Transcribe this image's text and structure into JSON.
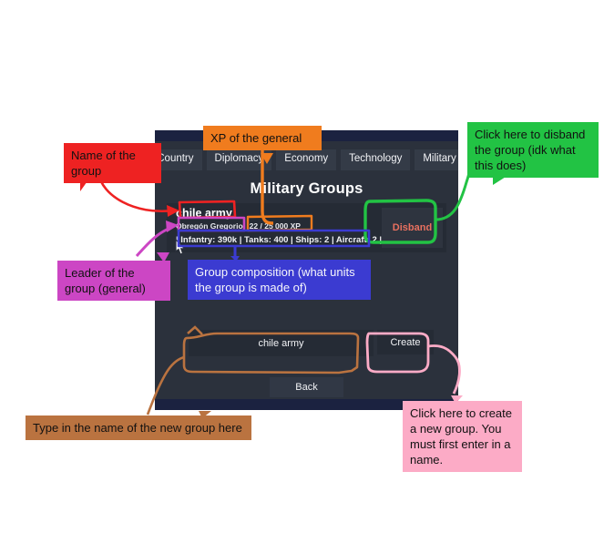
{
  "panel": {
    "title": "Military Groups",
    "nav_tabs": [
      {
        "label": "Country"
      },
      {
        "label": "Diplomacy"
      },
      {
        "label": "Economy"
      },
      {
        "label": "Technology"
      },
      {
        "label": "Military"
      }
    ],
    "groups": [
      {
        "name": "chile army",
        "general": "Obregón Gregorio",
        "xp": "22 / 25 000 XP",
        "units": "| Infantry: 390k | Tanks: 400 | Ships: 2 | Aircraft: 2 |",
        "disband_label": "Disband"
      }
    ],
    "create": {
      "input_value": "chile army",
      "input_placeholder": "",
      "create_label": "Create"
    },
    "back_label": "Back"
  },
  "annotations": {
    "name_of_group": "Name of the group",
    "xp_of_general": "XP of the general",
    "disband_group": "Click here to disband the group (idk what this does)",
    "leader_of_group": "Leader of the group (general)",
    "group_composition": "Group composition (what units the group is made of)",
    "type_new_group_name": "Type in the name of the new group here",
    "create_new_group": "Click here to create a new group. You must first enter in a name."
  },
  "colors": {
    "red": "#ee2222",
    "orange": "#f07c1e",
    "green": "#22c344",
    "purple": "#cc46c4",
    "blue": "#3b3bd1",
    "brown": "#ba7340",
    "pink": "#fcabc6",
    "panel_bg": "#2b313c",
    "panel_strip": "#1b2240",
    "disband_text": "#e8705f"
  }
}
